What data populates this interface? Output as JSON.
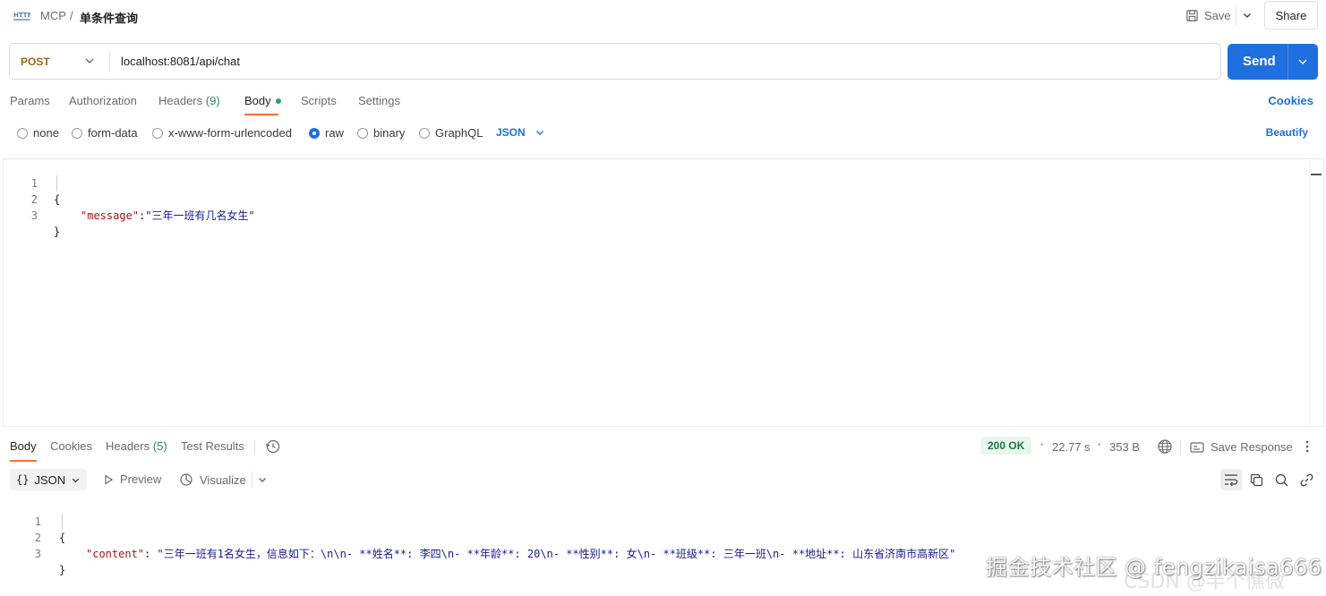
{
  "topbar": {
    "icon": "http-icon",
    "breadcrumb_parent": "MCP",
    "breadcrumb_sep": "/",
    "breadcrumb_current": "单条件查询",
    "save_label": "Save",
    "share_label": "Share"
  },
  "request": {
    "method": "POST",
    "url": "localhost:8081/api/chat",
    "send_label": "Send"
  },
  "request_tabs": {
    "items": [
      {
        "label": "Params"
      },
      {
        "label": "Authorization"
      },
      {
        "label": "Headers",
        "count": "(9)"
      },
      {
        "label": "Body"
      },
      {
        "label": "Scripts"
      },
      {
        "label": "Settings"
      }
    ],
    "active": "Body",
    "cookies_label": "Cookies"
  },
  "body_types": {
    "options": [
      "none",
      "form-data",
      "x-www-form-urlencoded",
      "raw",
      "binary",
      "GraphQL"
    ],
    "selected": "raw",
    "format": "JSON",
    "beautify_label": "Beautify"
  },
  "editor": {
    "lines": [
      {
        "n": "1",
        "text": "{"
      },
      {
        "n": "2",
        "key": "\"message\"",
        "sep": ":",
        "value": "\"三年一班有几名女生\""
      },
      {
        "n": "3",
        "text": "}"
      }
    ]
  },
  "response_tabs": {
    "items": [
      {
        "label": "Body"
      },
      {
        "label": "Cookies"
      },
      {
        "label": "Headers",
        "count": "(5)"
      },
      {
        "label": "Test Results"
      }
    ],
    "active": "Body",
    "status": "200 OK",
    "time": "22.77 s",
    "size": "353 B",
    "save_response_label": "Save Response"
  },
  "response_toolbar": {
    "format": "JSON",
    "preview_label": "Preview",
    "visualize_label": "Visualize"
  },
  "response_body": {
    "lines": [
      {
        "n": "1",
        "text": "{"
      },
      {
        "n": "2",
        "key": "\"content\"",
        "sep": ": ",
        "value": "\"三年一班有1名女生，信息如下：\\n\\n- **姓名**: 李四\\n- **年龄**: 20\\n- **性别**: 女\\n- **班级**: 三年一班\\n- **地址**: 山东省济南市高新区\""
      },
      {
        "n": "3",
        "text": "}"
      }
    ]
  },
  "watermark": {
    "text": "掘金技术社区 @ fengzikaisa666",
    "text2": "CSDN @半个憔微"
  },
  "colors": {
    "accent": "#1f6fde",
    "tab_underline": "#ff6c37",
    "method": "#a0661e",
    "status_ok": "#1d7a3e"
  }
}
